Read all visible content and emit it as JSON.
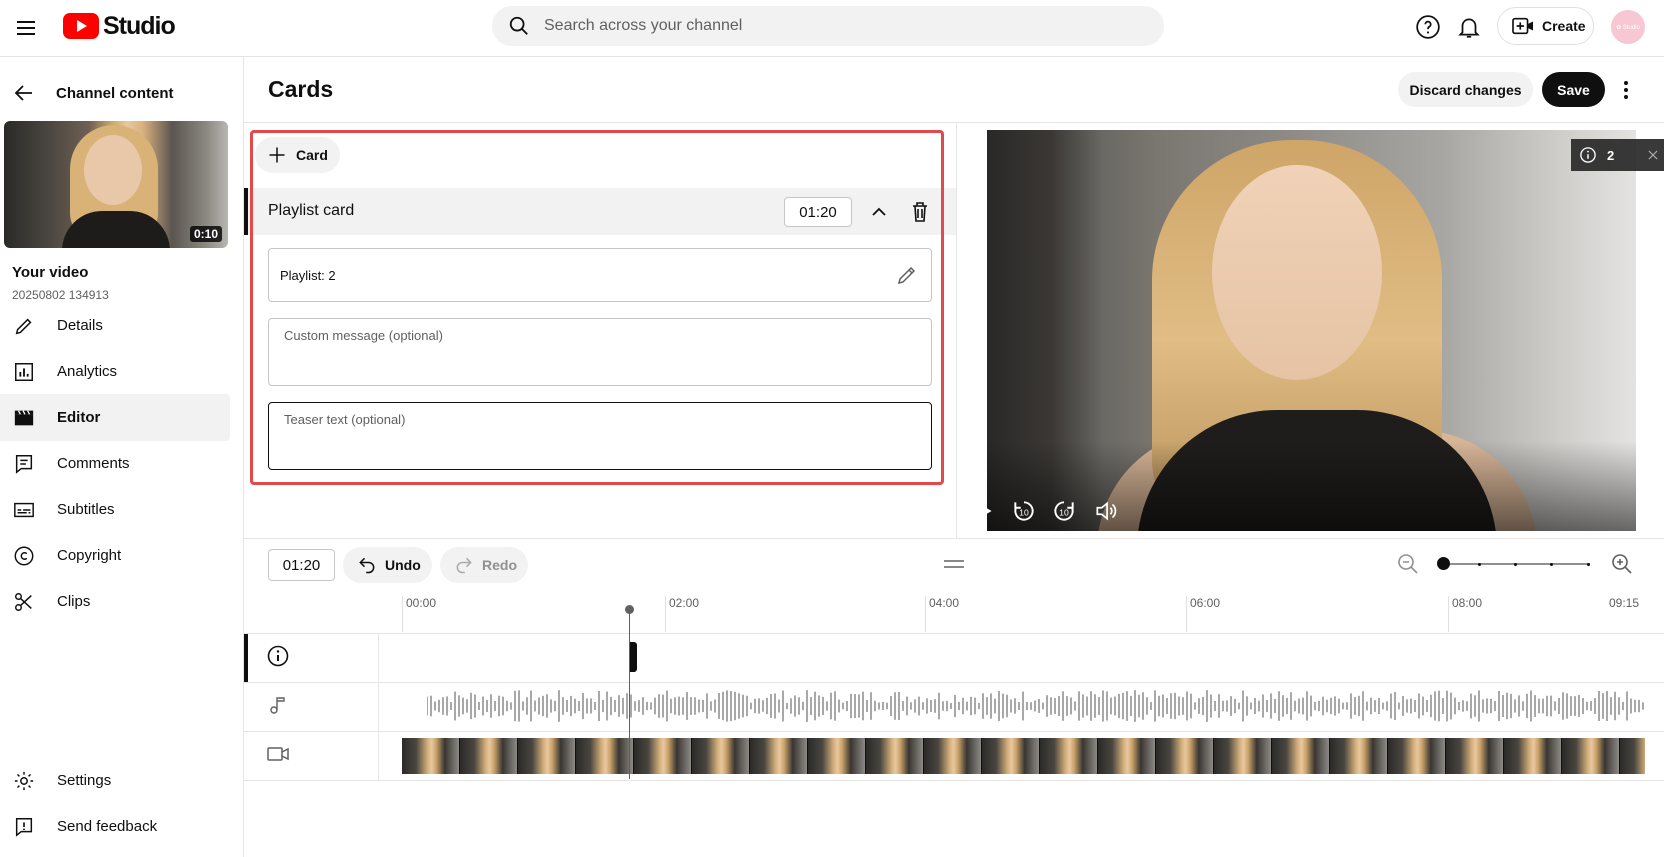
{
  "topbar": {
    "logo_text": "Studio",
    "search_placeholder": "Search across your channel",
    "create_label": "Create",
    "avatar_text": "✿ Studio"
  },
  "sidebar": {
    "back_label": "Channel content",
    "thumbnail_duration": "0:10",
    "video_heading": "Your video",
    "video_id": "20250802 134913",
    "items": [
      {
        "label": "Details",
        "icon": "pencil-icon"
      },
      {
        "label": "Analytics",
        "icon": "analytics-icon"
      },
      {
        "label": "Editor",
        "icon": "clapperboard-icon",
        "active": true
      },
      {
        "label": "Comments",
        "icon": "comment-icon"
      },
      {
        "label": "Subtitles",
        "icon": "subtitles-icon"
      },
      {
        "label": "Copyright",
        "icon": "copyright-icon"
      },
      {
        "label": "Clips",
        "icon": "scissors-icon"
      }
    ],
    "bottom_items": [
      {
        "label": "Settings",
        "icon": "gear-icon"
      },
      {
        "label": "Send feedback",
        "icon": "feedback-icon"
      }
    ]
  },
  "header": {
    "title": "Cards",
    "discard_label": "Discard changes",
    "save_label": "Save"
  },
  "cards": {
    "add_label": "Card",
    "card_type": "Playlist card",
    "card_time": "01:20",
    "playlist_value": "Playlist: 2",
    "custom_message_placeholder": "Custom message (optional)",
    "teaser_placeholder": "Teaser text (optional)"
  },
  "preview": {
    "info_count": "2"
  },
  "timeline": {
    "current_time": "01:20",
    "undo_label": "Undo",
    "redo_label": "Redo",
    "ruler": [
      "00:00",
      "02:00",
      "04:00",
      "06:00",
      "08:00",
      "09:15"
    ]
  },
  "colors": {
    "accent": "#0f0f0f",
    "highlight": "#e04a4a",
    "youtube_red": "#ff0000"
  }
}
